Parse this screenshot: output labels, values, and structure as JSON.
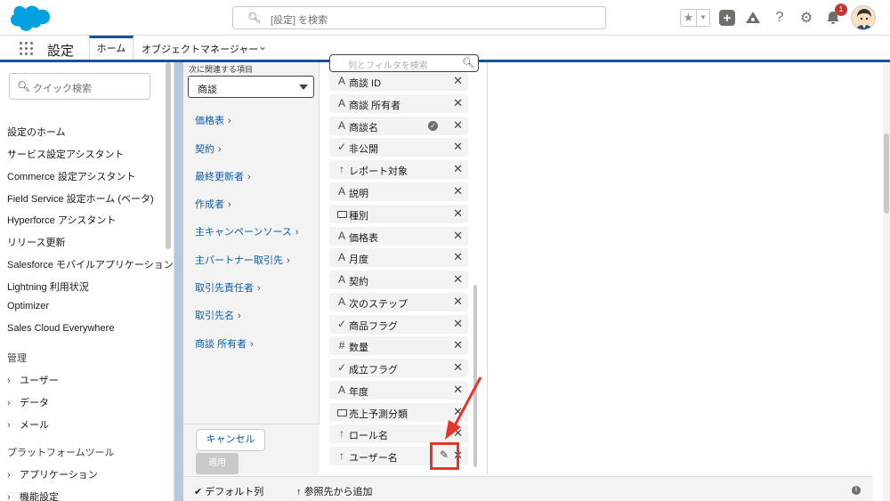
{
  "header": {
    "search_placeholder": "[設定] を検索",
    "notification_count": "1",
    "icons": [
      "salesforce-cloud-icon",
      "search-icon",
      "star-icon",
      "chevron-down-icon",
      "add-icon",
      "trailhead-icon",
      "help-icon",
      "gear-icon",
      "bell-icon",
      "avatar"
    ]
  },
  "nav": {
    "app_name": "設定",
    "tabs": [
      {
        "label": "ホーム",
        "active": true
      },
      {
        "label": "オブジェクトマネージャー",
        "active": false
      }
    ]
  },
  "sidebar": {
    "search_placeholder": "クイック検索",
    "items": [
      "設定のホーム",
      "サービス設定アシスタント",
      "Commerce 設定アシスタント",
      "Field Service 設定ホーム (ベータ)",
      "Hyperforce アシスタント",
      "リリース更新",
      "Salesforce モバイルアプリケーション",
      "Lightning 利用状況",
      "Optimizer",
      "Sales Cloud Everywhere"
    ],
    "section_admin": "管理",
    "admin_items": [
      "ユーザー",
      "データ",
      "メール"
    ],
    "section_platform": "プラットフォームツール",
    "platform_items": [
      "アプリケーション",
      "機能設定"
    ]
  },
  "related": {
    "label": "次に関連する項目",
    "selected": "商談",
    "links": [
      "価格表",
      "契約",
      "最終更新者",
      "作成者",
      "主キャンペーンソース",
      "主パートナー取引先",
      "取引先責任者",
      "取引先名",
      "商談 所有者"
    ]
  },
  "columns_panel": {
    "search_placeholder": "列とフィルタを検索",
    "fields": [
      {
        "label": "商談 ID",
        "icon": "text-icon"
      },
      {
        "label": "商談 所有者",
        "icon": "text-icon"
      },
      {
        "label": "商談名",
        "icon": "text-icon",
        "checked": true
      },
      {
        "label": "非公開",
        "icon": "checkmark-icon"
      },
      {
        "label": "レポート対象",
        "icon": "arrow-up-icon"
      },
      {
        "label": "説明",
        "icon": "text-icon"
      },
      {
        "label": "種別",
        "icon": "picklist-icon"
      },
      {
        "label": "価格表",
        "icon": "text-icon"
      },
      {
        "label": "月度",
        "icon": "text-icon"
      },
      {
        "label": "契約",
        "icon": "text-icon"
      },
      {
        "label": "次のステップ",
        "icon": "text-icon"
      },
      {
        "label": "商品フラグ",
        "icon": "checkmark-icon"
      },
      {
        "label": "数量",
        "icon": "number-icon"
      },
      {
        "label": "成立フラグ",
        "icon": "checkmark-icon"
      },
      {
        "label": "年度",
        "icon": "text-icon"
      },
      {
        "label": "売上予測分類",
        "icon": "picklist-icon"
      },
      {
        "label": "ロール名",
        "icon": "arrow-up-icon"
      },
      {
        "label": "ユーザー名",
        "icon": "arrow-up-icon",
        "editing": true
      }
    ]
  },
  "buttons": {
    "cancel": "キャンセル",
    "apply": "適用"
  },
  "footer": {
    "default_columns": "デフォルト列",
    "add_from_reference": "参照先から追加"
  },
  "colors": {
    "brand_blue": "#1b5297",
    "link_blue": "#0b5cab",
    "highlight_red": "#e8352a",
    "badge_red": "#c23934"
  }
}
